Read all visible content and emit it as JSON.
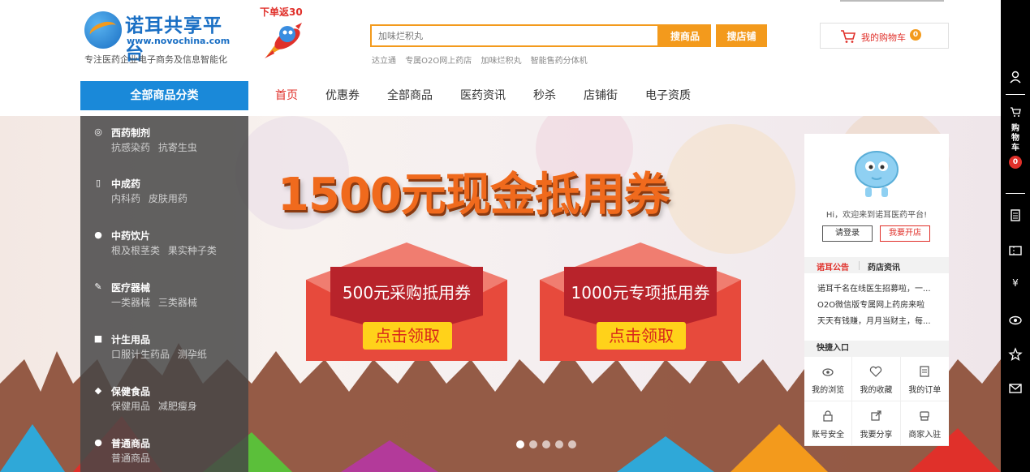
{
  "logo": {
    "title": "诺耳共享平台",
    "url": "www.novochina.com",
    "slogan": "专注医药企业电子商务及信息智能化"
  },
  "promo_badge": {
    "text": "下单返30"
  },
  "search": {
    "placeholder": "加味烂积丸",
    "search_goods_label": "搜商品",
    "search_shop_label": "搜店铺",
    "hot_words": [
      "达立通",
      "专属O2O网上药店",
      "加味烂积丸",
      "智能售药分体机"
    ]
  },
  "cart": {
    "label": "我的购物车",
    "count": "0"
  },
  "category_header": "全部商品分类",
  "nav": [
    {
      "label": "首页",
      "active": true
    },
    {
      "label": "优惠券"
    },
    {
      "label": "全部商品"
    },
    {
      "label": "医药资讯"
    },
    {
      "label": "秒杀"
    },
    {
      "label": "店铺街"
    },
    {
      "label": "电子资质"
    }
  ],
  "categories": [
    {
      "title": "西药制剂",
      "subs": [
        "抗感染药",
        "抗寄生虫"
      ],
      "icon": "pill-icon"
    },
    {
      "title": "中成药",
      "subs": [
        "内科药",
        "皮肤用药"
      ],
      "icon": "bottle-icon"
    },
    {
      "title": "中药饮片",
      "subs": [
        "根及根茎类",
        "果实种子类"
      ],
      "icon": "herb-icon"
    },
    {
      "title": "医疗器械",
      "subs": [
        "一类器械",
        "三类器械"
      ],
      "icon": "syringe-icon"
    },
    {
      "title": "计生用品",
      "subs": [
        "口服计生药品",
        "测孕纸"
      ],
      "icon": "box-icon"
    },
    {
      "title": "保健食品",
      "subs": [
        "保健用品",
        "减肥瘦身"
      ],
      "icon": "health-icon"
    },
    {
      "title": "普通商品",
      "subs": [
        "普通商品"
      ],
      "icon": "circle-icon"
    }
  ],
  "banner": {
    "title": "1500元现金抵用券",
    "coupons": [
      {
        "label": "500元采购抵用券",
        "button": "点击领取"
      },
      {
        "label": "1000元专项抵用券",
        "button": "点击领取"
      }
    ],
    "dot_count": 5,
    "active_dot": 0
  },
  "user_panel": {
    "welcome": "Hi，欢迎来到诺耳医药平台!",
    "login_label": "请登录",
    "open_shop_label": "我要开店",
    "tabs": [
      "诺耳公告",
      "药店资讯"
    ],
    "news": [
      "诺耳千名在线医生招募啦，一...",
      "O2O微信版专属网上药房来啦",
      "天天有钱赚，月月当财主，每..."
    ],
    "quick_header": "快捷入口",
    "quick_links": [
      {
        "label": "我的浏览",
        "icon": "eye-icon"
      },
      {
        "label": "我的收藏",
        "icon": "heart-icon"
      },
      {
        "label": "我的订单",
        "icon": "order-icon"
      },
      {
        "label": "账号安全",
        "icon": "lock-icon"
      },
      {
        "label": "我要分享",
        "icon": "share-icon"
      },
      {
        "label": "商家入驻",
        "icon": "store-icon"
      }
    ]
  },
  "toolbar": {
    "cart_label": "购物车",
    "cart_count": "0",
    "yen": "¥"
  },
  "colors": {
    "accent_orange": "#f39a1c",
    "brand_blue": "#1a89d9",
    "alert_red": "#e0302a"
  }
}
